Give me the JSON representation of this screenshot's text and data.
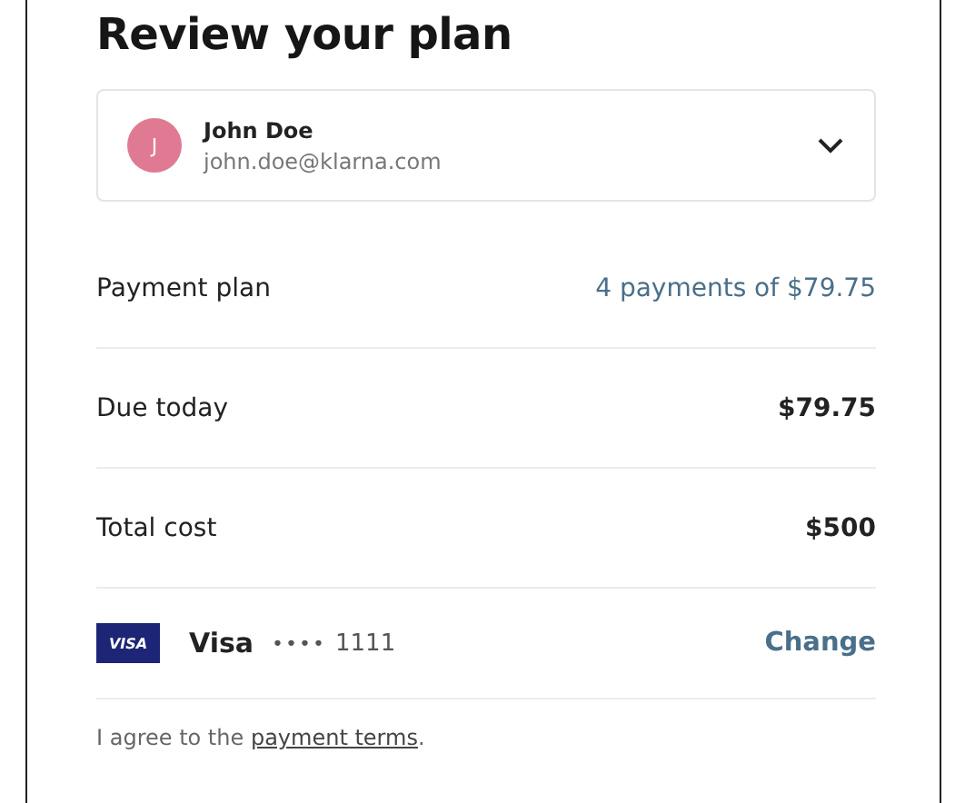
{
  "title": "Review your plan",
  "account": {
    "initial": "J",
    "name": "John Doe",
    "email": "john.doe@klarna.com",
    "color": "#e07a93"
  },
  "rows": [
    {
      "label": "Payment plan",
      "value": "4 payments of $79.75",
      "kind": "link"
    },
    {
      "label": "Due today",
      "value": "$79.75",
      "kind": "amount"
    },
    {
      "label": "Total cost",
      "value": "$500",
      "kind": "amount"
    }
  ],
  "payment_method": {
    "badge": "VISA",
    "brand": "Visa",
    "mask": "••••",
    "last4": "1111",
    "action": "Change"
  },
  "agreement": {
    "before": "I agree to the ",
    "link": "payment terms",
    "after": "."
  }
}
